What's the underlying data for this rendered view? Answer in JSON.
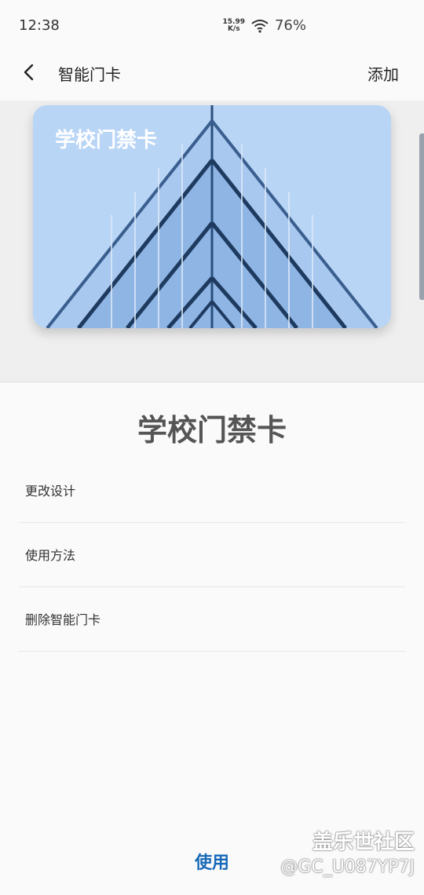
{
  "status_bar": {
    "time": "12:38",
    "net_speed_value": "15.99",
    "net_speed_unit": "K/s",
    "battery": "76%"
  },
  "app_bar": {
    "title": "智能门卡",
    "add_label": "添加"
  },
  "card": {
    "label": "学校门禁卡",
    "bg_color": "#b9d5f6"
  },
  "sheet": {
    "title": "学校门禁卡",
    "items": [
      {
        "label": "更改设计"
      },
      {
        "label": "使用方法"
      },
      {
        "label": "删除智能门卡"
      }
    ],
    "use_label": "使用",
    "accent_color": "#1769b8"
  },
  "watermark": {
    "title": "盖乐世社区",
    "handle": "@GC_U087YP7J"
  }
}
